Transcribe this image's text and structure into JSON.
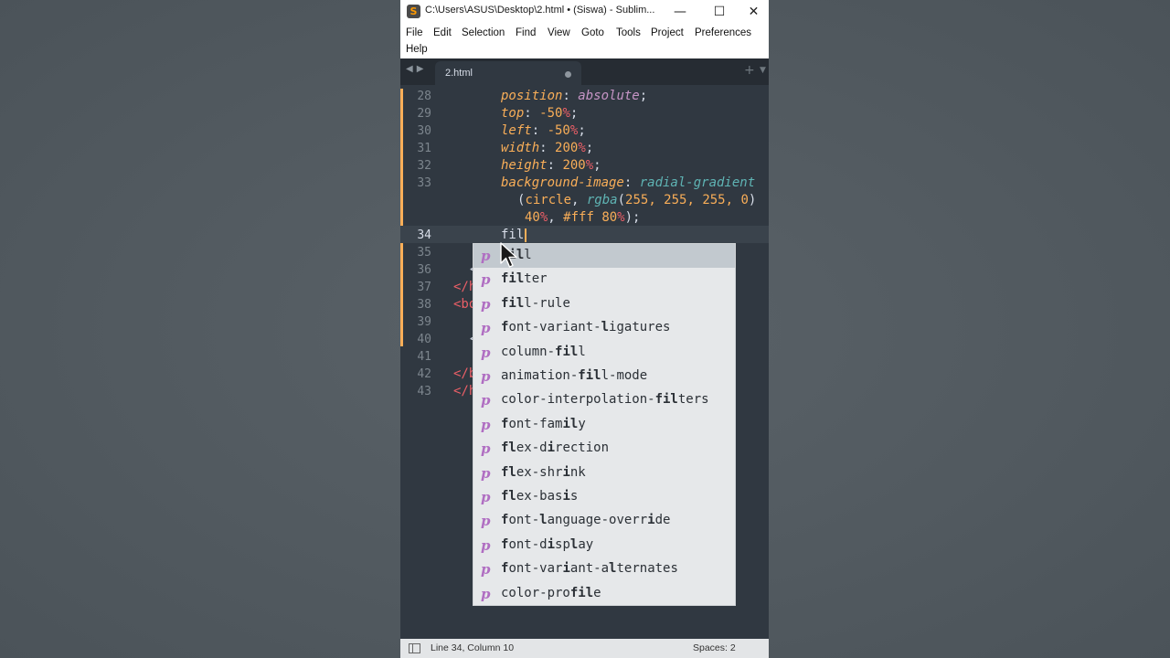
{
  "window": {
    "title": "C:\\Users\\ASUS\\Desktop\\2.html • (Siswa) - Sublim...",
    "app_icon": "sublime-text-icon",
    "controls": {
      "minimize": "—",
      "maximize": "☐",
      "close": "✕"
    }
  },
  "menu": [
    "File",
    "Edit",
    "Selection",
    "Find",
    "View",
    "Goto",
    "Tools",
    "Project",
    "Preferences",
    "Help"
  ],
  "tabs": [
    {
      "label": "2.html",
      "dirty": true
    }
  ],
  "tabbar": {
    "new_tab_icon": "plus-icon",
    "tab_menu_icon": "caret-down-icon",
    "nav_icon": "tab-nav-arrows-icon"
  },
  "editor": {
    "current_line": "34",
    "line_numbers": [
      "28",
      "29",
      "30",
      "31",
      "32",
      "33",
      "",
      "",
      "34",
      "35",
      "36",
      "37",
      "38",
      "39",
      "40",
      "41",
      "42",
      "43"
    ],
    "lines": {
      "l28": {
        "prop": "position",
        "val": "absolute"
      },
      "l29": {
        "prop": "top",
        "num": "-50",
        "unit": "%"
      },
      "l30": {
        "prop": "left",
        "num": "-50",
        "unit": "%"
      },
      "l31": {
        "prop": "width",
        "num": "200",
        "unit": "%"
      },
      "l32": {
        "prop": "height",
        "num": "200",
        "unit": "%"
      },
      "l33": {
        "prop": "background-image",
        "fn": "radial-gradient"
      },
      "l33b": {
        "circle": "circle",
        "rgba": "rgba",
        "args": "255, 255, 255, 0"
      },
      "l33c": {
        "num1": "40",
        "unit1": "%",
        "color": "#fff",
        "num2": "80",
        "unit2": "%"
      },
      "l34": {
        "typed": "fil"
      },
      "fragments": {
        "l36": "<",
        "l37": "</h",
        "l38": "<bo",
        "l40": "<",
        "l42": "</b",
        "l43": "</h"
      }
    }
  },
  "autocomplete": {
    "kind_glyph": "p",
    "selected_index": 0,
    "items": [
      {
        "parts": [
          [
            "fil",
            true
          ],
          [
            "l",
            false
          ]
        ]
      },
      {
        "parts": [
          [
            "fil",
            true
          ],
          [
            "ter",
            false
          ]
        ]
      },
      {
        "parts": [
          [
            "fil",
            true
          ],
          [
            "l-rule",
            false
          ]
        ]
      },
      {
        "parts": [
          [
            "f",
            true
          ],
          [
            "ont-variant-",
            false
          ],
          [
            "l",
            true
          ],
          [
            "igatures",
            false
          ]
        ]
      },
      {
        "parts": [
          [
            "column-",
            false
          ],
          [
            "fil",
            true
          ],
          [
            "l",
            false
          ]
        ]
      },
      {
        "parts": [
          [
            "animation-",
            false
          ],
          [
            "fil",
            true
          ],
          [
            "l-mode",
            false
          ]
        ]
      },
      {
        "parts": [
          [
            "color-interpolation-",
            false
          ],
          [
            "fil",
            true
          ],
          [
            "ters",
            false
          ]
        ]
      },
      {
        "parts": [
          [
            "f",
            true
          ],
          [
            "ont-fam",
            false
          ],
          [
            "il",
            true
          ],
          [
            "y",
            false
          ]
        ]
      },
      {
        "parts": [
          [
            "fl",
            true
          ],
          [
            "ex-d",
            false
          ],
          [
            "i",
            true
          ],
          [
            "rection",
            false
          ]
        ]
      },
      {
        "parts": [
          [
            "fl",
            true
          ],
          [
            "ex-shr",
            false
          ],
          [
            "i",
            true
          ],
          [
            "nk",
            false
          ]
        ]
      },
      {
        "parts": [
          [
            "fl",
            true
          ],
          [
            "ex-bas",
            false
          ],
          [
            "i",
            true
          ],
          [
            "s",
            false
          ]
        ]
      },
      {
        "parts": [
          [
            "f",
            true
          ],
          [
            "ont-",
            false
          ],
          [
            "l",
            true
          ],
          [
            "anguage-overr",
            false
          ],
          [
            "i",
            true
          ],
          [
            "de",
            false
          ]
        ]
      },
      {
        "parts": [
          [
            "f",
            true
          ],
          [
            "ont-d",
            false
          ],
          [
            "i",
            true
          ],
          [
            "sp",
            false
          ],
          [
            "l",
            true
          ],
          [
            "ay",
            false
          ]
        ]
      },
      {
        "parts": [
          [
            "f",
            true
          ],
          [
            "ont-var",
            false
          ],
          [
            "i",
            true
          ],
          [
            "ant-a",
            false
          ],
          [
            "l",
            true
          ],
          [
            "ternates",
            false
          ]
        ]
      },
      {
        "parts": [
          [
            "color-pro",
            false
          ],
          [
            "fil",
            true
          ],
          [
            "e",
            false
          ]
        ]
      }
    ]
  },
  "statusbar": {
    "position": "Line 34, Column 10",
    "indent": "Spaces: 2",
    "panel_icon": "panel-toggle-icon"
  }
}
